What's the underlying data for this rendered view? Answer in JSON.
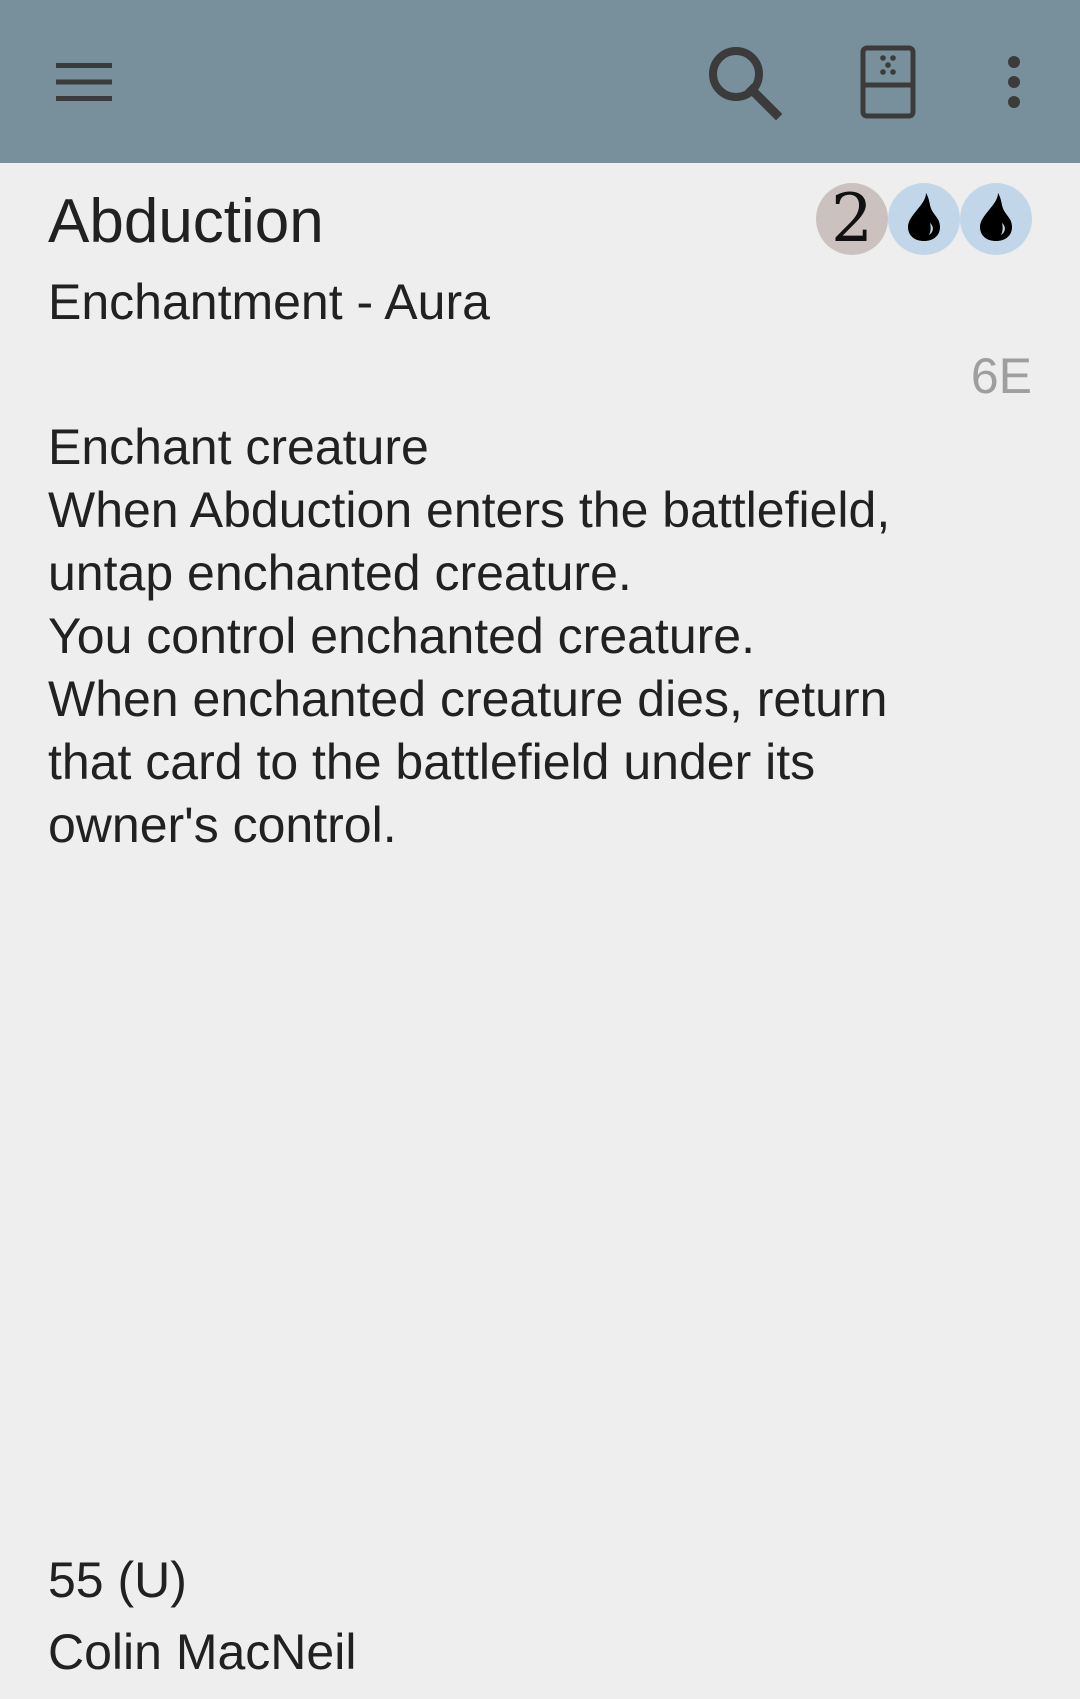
{
  "toolbar": {
    "background_color": "#78909c",
    "icon_color": "#3b3b3b",
    "icons": [
      "menu-icon",
      "search-icon",
      "random-card-icon",
      "more-vert-icon"
    ]
  },
  "card": {
    "name": "Abduction",
    "type_line": "Enchantment - Aura",
    "set_code": "6E",
    "mana_cost": [
      {
        "symbol": "2",
        "kind": "generic",
        "color": "#cbc2bf"
      },
      {
        "symbol": "",
        "kind": "blue-drop",
        "color": "#c1d7e9"
      },
      {
        "symbol": "",
        "kind": "blue-drop",
        "color": "#c1d7e9"
      }
    ],
    "rules_text": [
      "Enchant creature",
      "When Abduction enters the battlefield,",
      "untap enchanted creature.",
      "You control enchanted creature.",
      "When enchanted creature dies, return",
      "that card to the battlefield under its",
      "owner's control."
    ],
    "collector_number": "55 (U)",
    "artist": "Colin MacNeil"
  },
  "colors": {
    "background": "#eeeeee",
    "text": "#212121",
    "set_text": "#9e9e9e"
  }
}
